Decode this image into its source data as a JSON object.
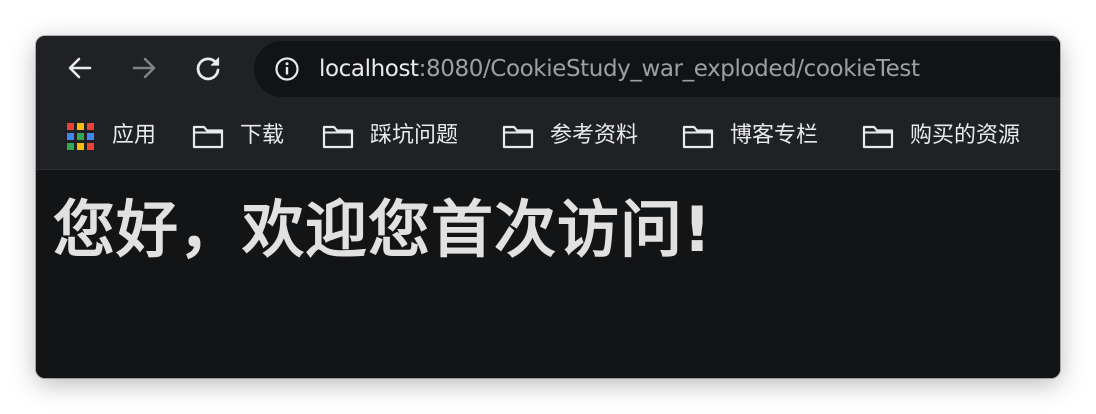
{
  "browser": {
    "url_host": "localhost",
    "url_rest": ":8080/CookieStudy_war_exploded/cookieTest",
    "icons": {
      "back": "arrow-left-icon",
      "forward": "arrow-right-icon",
      "reload": "reload-icon",
      "site_info": "info-icon"
    },
    "colors": {
      "toolbar_bg": "#202124",
      "omnibox_bg": "#121314",
      "page_bg": "#131416",
      "text_primary": "#e8eaed",
      "text_secondary": "#9aa0a6"
    }
  },
  "bookmarks": {
    "apps_label": "应用",
    "items": [
      {
        "label": "下载",
        "icon": "folder-icon"
      },
      {
        "label": "踩坑问题",
        "icon": "folder-icon"
      },
      {
        "label": "参考资料",
        "icon": "folder-icon"
      },
      {
        "label": "博客专栏",
        "icon": "folder-icon"
      },
      {
        "label": "购买的资源",
        "icon": "folder-icon"
      }
    ],
    "apps_colors": [
      "#ea4335",
      "#fbbc04",
      "#ea4335",
      "#4285f4",
      "#34a853",
      "#4285f4",
      "#34a853",
      "#fbbc04",
      "#ea4335"
    ]
  },
  "page": {
    "heading": "您好，欢迎您首次访问!"
  }
}
